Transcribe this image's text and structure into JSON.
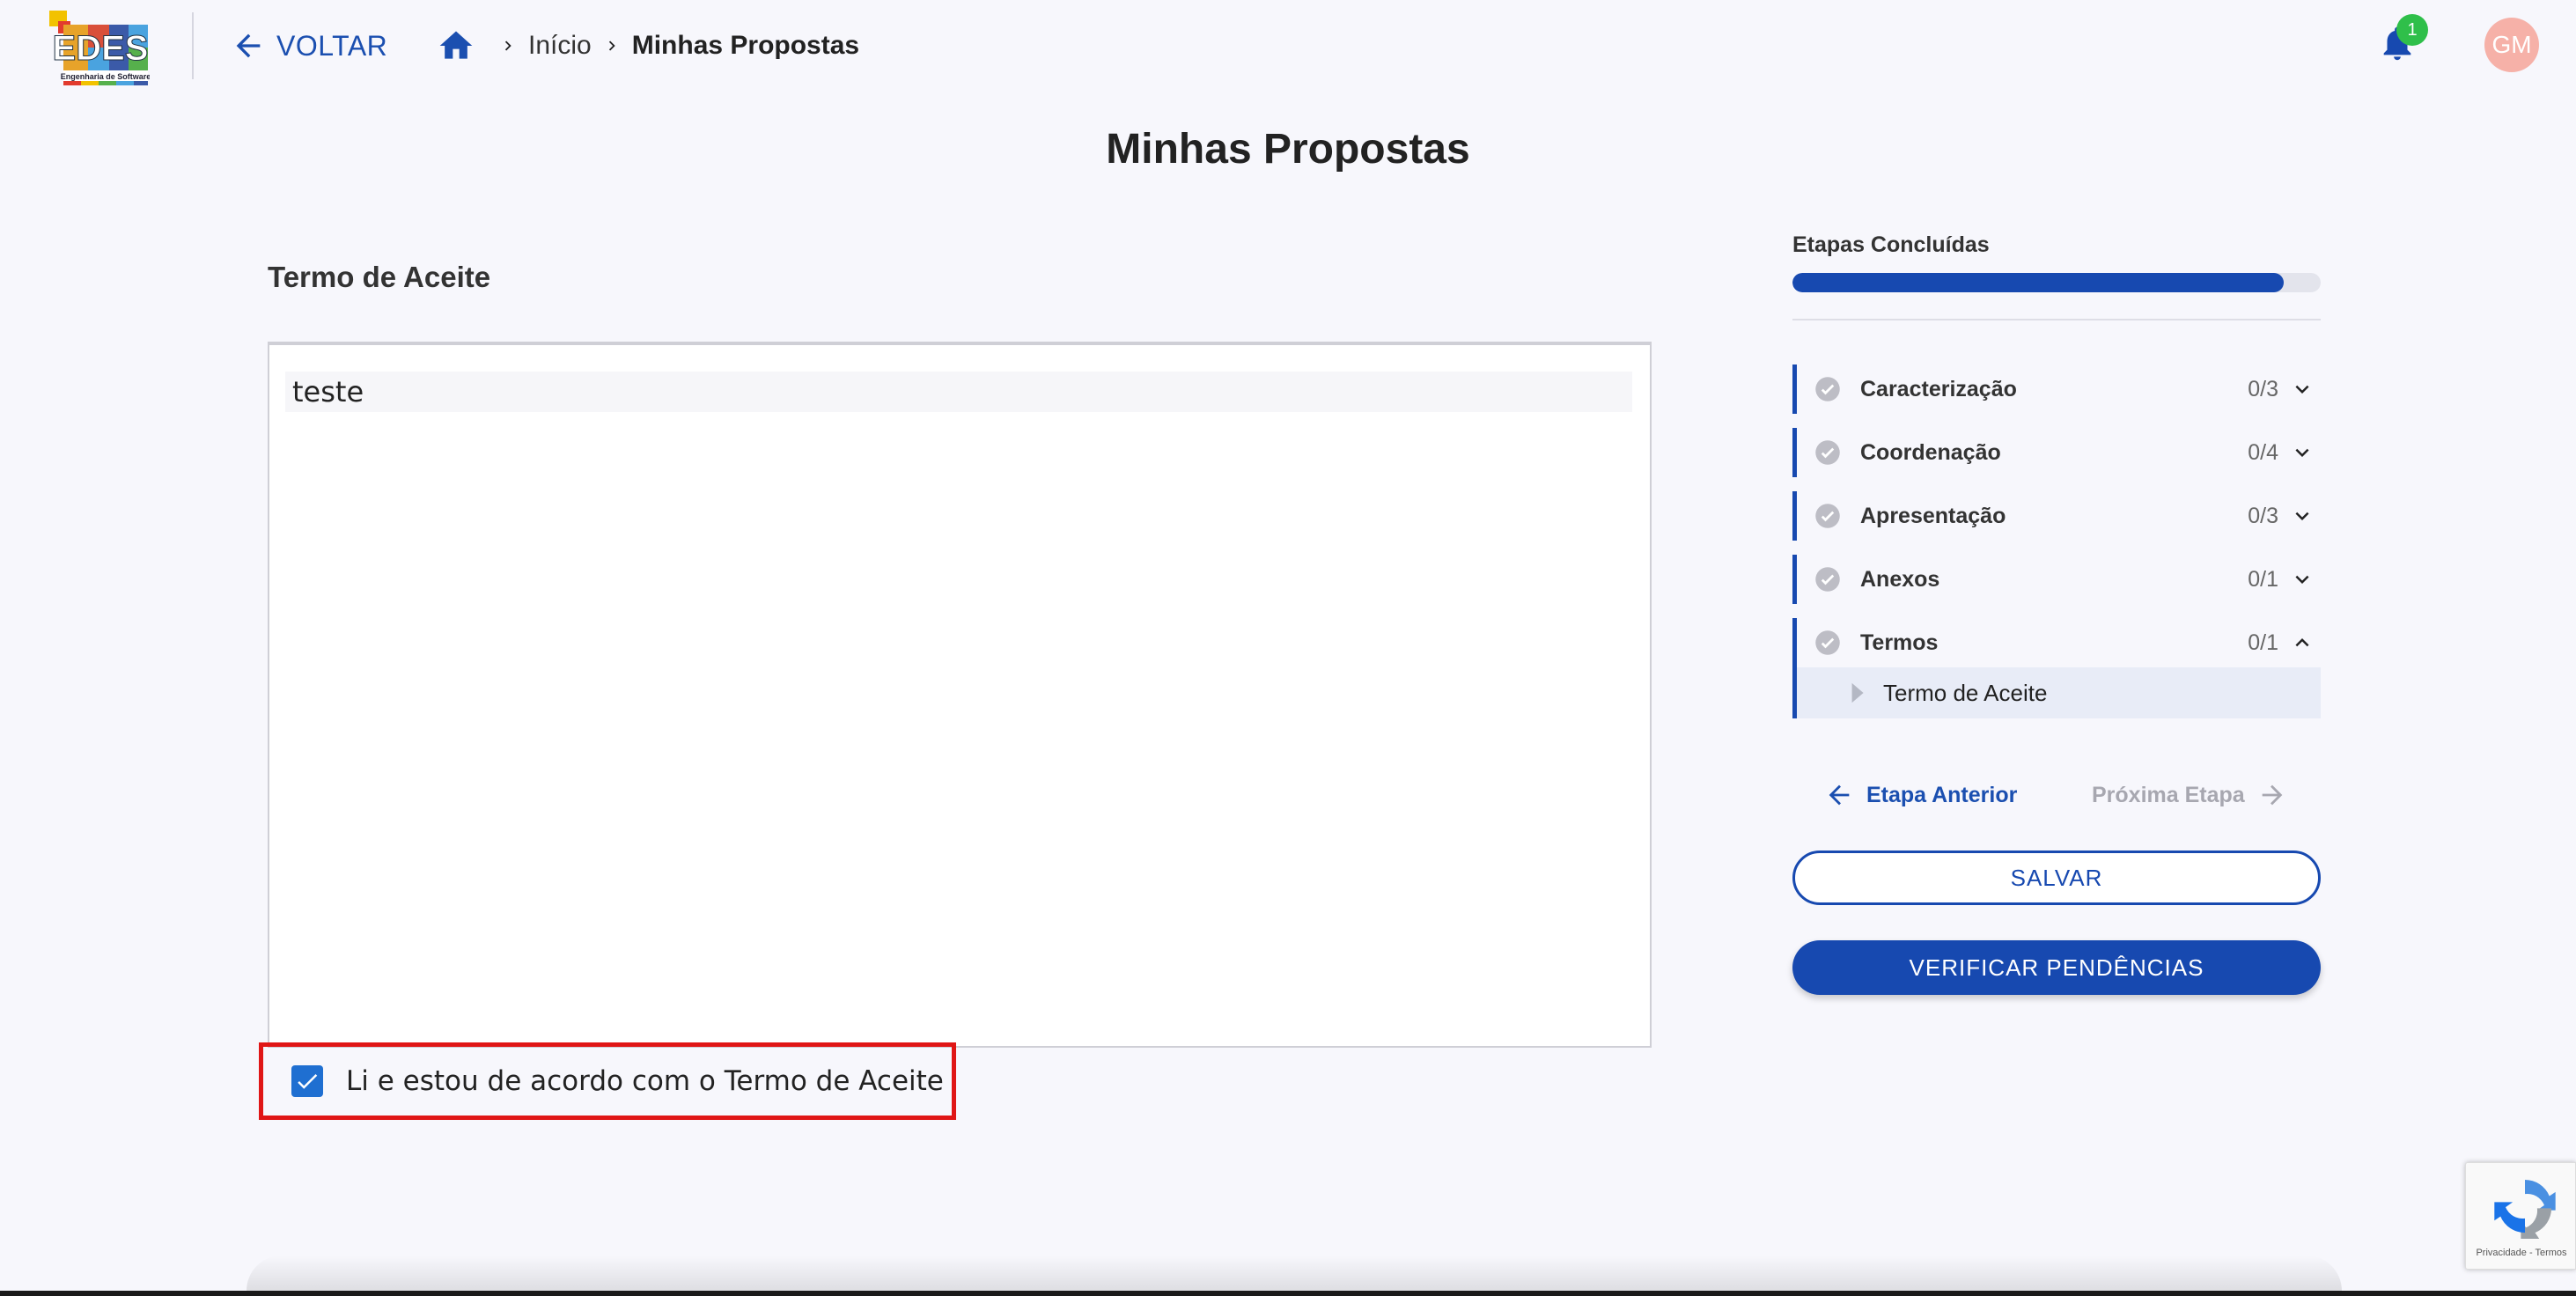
{
  "header": {
    "back_label": "VOLTAR",
    "breadcrumb": {
      "home": "Início",
      "current": "Minhas Propostas"
    },
    "notification_count": "1",
    "avatar_initials": "GM",
    "logo_text": "EDES",
    "logo_subtext": "Engenharia de Software"
  },
  "page": {
    "title": "Minhas Propostas"
  },
  "form": {
    "section_title": "Termo de Aceite",
    "term_text": "teste",
    "accept_label": "Li e estou de acordo com o Termo de Aceite",
    "accept_checked": true
  },
  "sidebar": {
    "progress_title": "Etapas Concluídas",
    "progress_fraction": 0.93,
    "steps": [
      {
        "label": "Caracterização",
        "count": "0/3",
        "expanded": false
      },
      {
        "label": "Coordenação",
        "count": "0/4",
        "expanded": false
      },
      {
        "label": "Apresentação",
        "count": "0/3",
        "expanded": false
      },
      {
        "label": "Anexos",
        "count": "0/1",
        "expanded": false
      },
      {
        "label": "Termos",
        "count": "0/1",
        "expanded": true,
        "substeps": [
          "Termo de Aceite"
        ]
      }
    ],
    "prev_label": "Etapa Anterior",
    "next_label": "Próxima Etapa",
    "save_label": "SALVAR",
    "check_label": "VERIFICAR PENDÊNCIAS"
  },
  "recaptcha": {
    "footer": "Privacidade - Termos"
  },
  "colors": {
    "primary": "#1749b0",
    "highlight_border": "#e01616",
    "badge": "#2fbf4a",
    "avatar": "#f6b1a8"
  },
  "icons": [
    "logo",
    "arrow-left-icon",
    "home-icon",
    "chevron-right-icon",
    "bell-icon",
    "check-circle-icon",
    "chevron-down-icon",
    "chevron-up-icon",
    "caret-right-icon",
    "arrow-right-icon",
    "checkbox-checked-icon",
    "recaptcha-icon"
  ]
}
